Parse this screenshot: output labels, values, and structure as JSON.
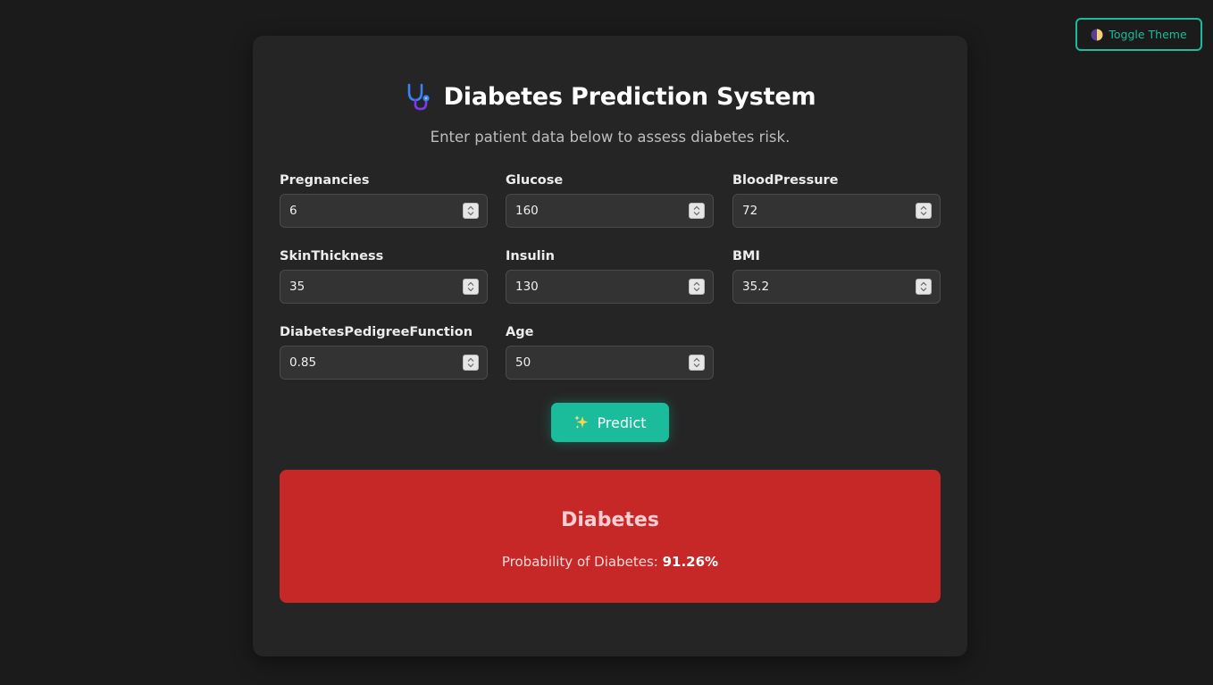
{
  "toolbar": {
    "toggle_theme_label": "Toggle Theme",
    "toggle_icon": "half-moon-icon"
  },
  "header": {
    "title": "Diabetes Prediction System",
    "title_icon": "stethoscope-icon",
    "subtitle": "Enter patient data below to assess diabetes risk."
  },
  "form": {
    "fields": [
      {
        "label": "Pregnancies",
        "value": "6"
      },
      {
        "label": "Glucose",
        "value": "160"
      },
      {
        "label": "BloodPressure",
        "value": "72"
      },
      {
        "label": "SkinThickness",
        "value": "35"
      },
      {
        "label": "Insulin",
        "value": "130"
      },
      {
        "label": "BMI",
        "value": "35.2"
      },
      {
        "label": "DiabetesPedigreeFunction",
        "value": "0.85"
      },
      {
        "label": "Age",
        "value": "50"
      }
    ],
    "predict_label": "Predict",
    "predict_icon": "sparkles-icon"
  },
  "result": {
    "title": "Diabetes",
    "probability_label": "Probability of Diabetes:",
    "probability_value": "91.26%",
    "color": "#c62828"
  },
  "colors": {
    "accent": "#1abc9c",
    "background": "#1b1b1b",
    "card": "#252525"
  }
}
